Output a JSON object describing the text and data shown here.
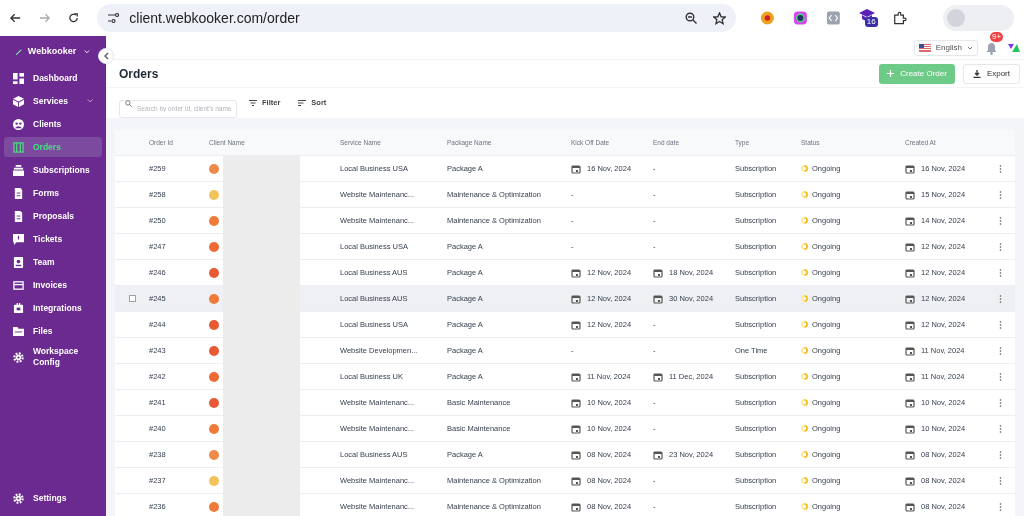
{
  "browser": {
    "url": "client.webkooker.com/order",
    "extension_badge": "16"
  },
  "sidebar": {
    "brand": "Webkooker",
    "items": [
      {
        "label": "Dashboard",
        "selected": false,
        "expandable": false
      },
      {
        "label": "Services",
        "selected": false,
        "expandable": true
      },
      {
        "label": "Clients",
        "selected": false,
        "expandable": false
      },
      {
        "label": "Orders",
        "selected": true,
        "expandable": false
      },
      {
        "label": "Subscriptions",
        "selected": false,
        "expandable": false
      },
      {
        "label": "Forms",
        "selected": false,
        "expandable": false
      },
      {
        "label": "Proposals",
        "selected": false,
        "expandable": false
      },
      {
        "label": "Tickets",
        "selected": false,
        "expandable": false
      },
      {
        "label": "Team",
        "selected": false,
        "expandable": false
      },
      {
        "label": "Invoices",
        "selected": false,
        "expandable": false
      },
      {
        "label": "Integrations",
        "selected": false,
        "expandable": false
      },
      {
        "label": "Files",
        "selected": false,
        "expandable": false
      },
      {
        "label": "Workspace Config",
        "selected": false,
        "expandable": false
      }
    ],
    "footer": "Settings"
  },
  "topbar": {
    "language": "English",
    "notification_count": "9+"
  },
  "page": {
    "title": "Orders",
    "create_button": "Create Order",
    "export_button": "Export",
    "search_placeholder": "Search by order id, client's name",
    "filter": "Filter",
    "sort": "Sort"
  },
  "table": {
    "columns": [
      "Order Id",
      "Client Name",
      "Service Name",
      "Package Name",
      "Kick Off Date",
      "End date",
      "Type",
      "Status",
      "Created At"
    ],
    "rows": [
      {
        "id": "#259",
        "color": "#f08a4b",
        "service": "Local Business USA",
        "package": "Package A",
        "kickoff": "16 Nov, 2024",
        "end": "-",
        "type": "Subscription",
        "status": "Ongoing",
        "created": "16 Nov, 2024",
        "hovered": false
      },
      {
        "id": "#258",
        "color": "#f2c35b",
        "service": "Website Maintenanc...",
        "package": "Maintenance & Optimization",
        "kickoff": "-",
        "end": "-",
        "type": "Subscription",
        "status": "Ongoing",
        "created": "15 Nov, 2024",
        "hovered": false
      },
      {
        "id": "#250",
        "color": "#f07a3a",
        "service": "Website Maintenanc...",
        "package": "Maintenance & Optimization",
        "kickoff": "-",
        "end": "-",
        "type": "Subscription",
        "status": "Ongoing",
        "created": "14 Nov, 2024",
        "hovered": false
      },
      {
        "id": "#247",
        "color": "#ee6a35",
        "service": "Local Business USA",
        "package": "Package A",
        "kickoff": "-",
        "end": "-",
        "type": "Subscription",
        "status": "Ongoing",
        "created": "12 Nov, 2024",
        "hovered": false
      },
      {
        "id": "#246",
        "color": "#e85a35",
        "service": "Local Business AUS",
        "package": "Package A",
        "kickoff": "12 Nov, 2024",
        "end": "18 Nov, 2024",
        "type": "Subscription",
        "status": "Ongoing",
        "created": "12 Nov, 2024",
        "hovered": false
      },
      {
        "id": "#245",
        "color": "#f07a3a",
        "service": "Local Business AUS",
        "package": "Package A",
        "kickoff": "12 Nov, 2024",
        "end": "30 Nov, 2024",
        "type": "Subscription",
        "status": "Ongoing",
        "created": "12 Nov, 2024",
        "hovered": true
      },
      {
        "id": "#244",
        "color": "#e85a35",
        "service": "Local Business USA",
        "package": "Package A",
        "kickoff": "12 Nov, 2024",
        "end": "-",
        "type": "Subscription",
        "status": "Ongoing",
        "created": "12 Nov, 2024",
        "hovered": false
      },
      {
        "id": "#243",
        "color": "#e85a35",
        "service": "Website Developmen...",
        "package": "Package A",
        "kickoff": "-",
        "end": "-",
        "type": "One Time",
        "status": "Ongoing",
        "created": "11 Nov, 2024",
        "hovered": false
      },
      {
        "id": "#242",
        "color": "#ee6a35",
        "service": "Local Business UK",
        "package": "Package A",
        "kickoff": "11 Nov, 2024",
        "end": "11 Dec, 2024",
        "type": "Subscription",
        "status": "Ongoing",
        "created": "11 Nov, 2024",
        "hovered": false
      },
      {
        "id": "#241",
        "color": "#e85a35",
        "service": "Website Maintenanc...",
        "package": "Basic Maintenance",
        "kickoff": "10 Nov, 2024",
        "end": "-",
        "type": "Subscription",
        "status": "Ongoing",
        "created": "10 Nov, 2024",
        "hovered": false
      },
      {
        "id": "#240",
        "color": "#f07a3a",
        "service": "Website Maintenanc...",
        "package": "Basic Maintenance",
        "kickoff": "10 Nov, 2024",
        "end": "-",
        "type": "Subscription",
        "status": "Ongoing",
        "created": "10 Nov, 2024",
        "hovered": false
      },
      {
        "id": "#238",
        "color": "#f08a4b",
        "service": "Local Business AUS",
        "package": "Package A",
        "kickoff": "08 Nov, 2024",
        "end": "23 Nov, 2024",
        "type": "Subscription",
        "status": "Ongoing",
        "created": "08 Nov, 2024",
        "hovered": false
      },
      {
        "id": "#237",
        "color": "#f2c35b",
        "service": "Website Maintenanc...",
        "package": "Maintenance & Optimization",
        "kickoff": "08 Nov, 2024",
        "end": "-",
        "type": "Subscription",
        "status": "Ongoing",
        "created": "08 Nov, 2024",
        "hovered": false
      },
      {
        "id": "#236",
        "color": "#f07a3a",
        "service": "Website Maintenanc...",
        "package": "Maintenance & Optimization",
        "kickoff": "08 Nov, 2024",
        "end": "-",
        "type": "Subscription",
        "status": "Ongoing",
        "created": "08 Nov, 2024",
        "hovered": false
      }
    ]
  }
}
